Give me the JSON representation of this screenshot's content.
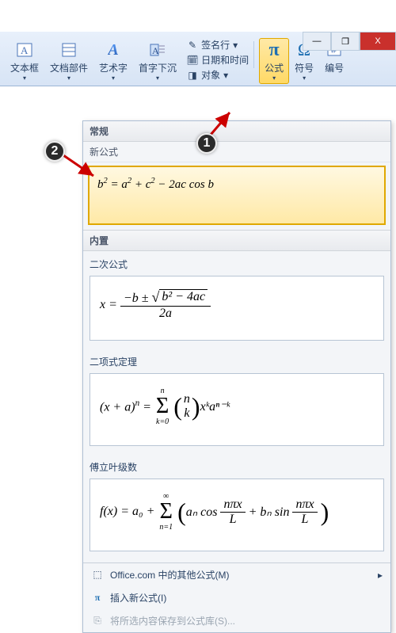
{
  "window": {
    "minimize": "—",
    "maximize": "❐",
    "close": "X"
  },
  "ribbon": {
    "textbox": "文本框",
    "docparts": "文档部件",
    "wordart": "艺术字",
    "dropcap": "首字下沉",
    "signature": "签名行",
    "datetime": "日期和时间",
    "object": "对象",
    "equation": "公式",
    "symbol": "符号",
    "number": "编号"
  },
  "dropdown": {
    "header": "常规",
    "new_label": "新公式",
    "builtins_header": "内置",
    "eq_new": "b² = a² + c² − 2ac cos b",
    "quadratic_title": "二次公式",
    "binomial_title": "二项式定理",
    "fourier_title": "傅立叶级数",
    "footer_office": "Office.com 中的其他公式(M)",
    "footer_insert": "插入新公式(I)",
    "footer_save": "将所选内容保存到公式库(S)..."
  },
  "math": {
    "quad_num_prefix": "−b ± ",
    "quad_radicand": "b² − 4ac",
    "quad_den": "2a",
    "quad_lhs": "x =",
    "binom_lhs": "(x + a)",
    "binom_exp": "n",
    "binom_bigop": "Σ",
    "binom_top": "n",
    "binom_bot": "k=0",
    "binom_top2": "n",
    "binom_bot2": "k",
    "binom_tail": " xᵏaⁿ⁻ᵏ",
    "four_lhs": "f(x) = a₀ + ",
    "four_bigop": "Σ",
    "four_top": "∞",
    "four_bot": "n=1",
    "four_body_a": "aₙ cos",
    "four_body_b": " + bₙ sin",
    "four_frac_num": "nπx",
    "four_frac_den": "L"
  },
  "annotations": {
    "step1": "1",
    "step2": "2"
  }
}
